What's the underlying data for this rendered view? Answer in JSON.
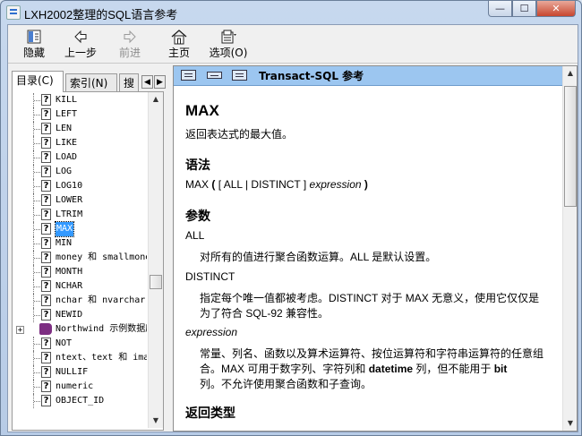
{
  "window": {
    "title": "LXH2002整理的SQL语言参考",
    "min_glyph": "—",
    "max_glyph": "☐",
    "close_glyph": "✕"
  },
  "toolbar": {
    "hide": "隐藏",
    "back": "上一步",
    "forward": "前进",
    "home": "主页",
    "options": "选项(O)"
  },
  "left": {
    "tabs": {
      "contents": "目录(C)",
      "index": "索引(N)",
      "search": "搜"
    },
    "tree": [
      {
        "label": "KILL",
        "kind": "topic"
      },
      {
        "label": "LEFT",
        "kind": "topic"
      },
      {
        "label": "LEN",
        "kind": "topic"
      },
      {
        "label": "LIKE",
        "kind": "topic"
      },
      {
        "label": "LOAD",
        "kind": "topic"
      },
      {
        "label": "LOG",
        "kind": "topic"
      },
      {
        "label": "LOG10",
        "kind": "topic"
      },
      {
        "label": "LOWER",
        "kind": "topic"
      },
      {
        "label": "LTRIM",
        "kind": "topic"
      },
      {
        "label": "MAX",
        "kind": "topic",
        "selected": true
      },
      {
        "label": "MIN",
        "kind": "topic"
      },
      {
        "label": "money 和 smallmoney",
        "kind": "topic"
      },
      {
        "label": "MONTH",
        "kind": "topic"
      },
      {
        "label": "NCHAR",
        "kind": "topic"
      },
      {
        "label": "nchar 和 nvarchar",
        "kind": "topic"
      },
      {
        "label": "NEWID",
        "kind": "topic"
      },
      {
        "label": "Northwind 示例数据库",
        "kind": "book"
      },
      {
        "label": "NOT",
        "kind": "topic"
      },
      {
        "label": "ntext、text 和 image",
        "kind": "topic"
      },
      {
        "label": "NULLIF",
        "kind": "topic"
      },
      {
        "label": "numeric",
        "kind": "topic"
      },
      {
        "label": "OBJECT_ID",
        "kind": "topic"
      }
    ],
    "tab_left_arrow": "◀",
    "tab_right_arrow": "▶",
    "expander_glyph": "+",
    "topic_glyph": "?"
  },
  "right": {
    "header_title": "Transact-SQL 参考",
    "h_max": "MAX",
    "desc": "返回表达式的最大值。",
    "h_syntax": "语法",
    "syntax_max": "MAX",
    "syntax_open": "(",
    "syntax_opts": "[ ALL | DISTINCT ]",
    "syntax_expr": "expression",
    "syntax_close": ")",
    "h_params": "参数",
    "all_term": "ALL",
    "all_desc": "对所有的值进行聚合函数运算。ALL 是默认设置。",
    "distinct_term": "DISTINCT",
    "distinct_desc1": "指定每个唯一值都被考虑。DISTINCT 对于 MAX 无意义，使用它仅仅是",
    "distinct_desc2": "为了符合 SQL-92 兼容性。",
    "expr_term": "expression",
    "expr_desc1": "常量、列名、函数以及算术运算符、按位运算符和字符串运算符的任意组",
    "expr_desc2a": "合。MAX 可用于数字列、字符列和 ",
    "expr_desc2b": "datetime",
    "expr_desc2c": " 列，但不能用于 ",
    "expr_desc2d": "bit",
    "expr_desc3": "列。不允许使用聚合函数和子查询。",
    "h_return": "返回类型"
  },
  "scroll": {
    "up": "▲",
    "down": "▼"
  }
}
